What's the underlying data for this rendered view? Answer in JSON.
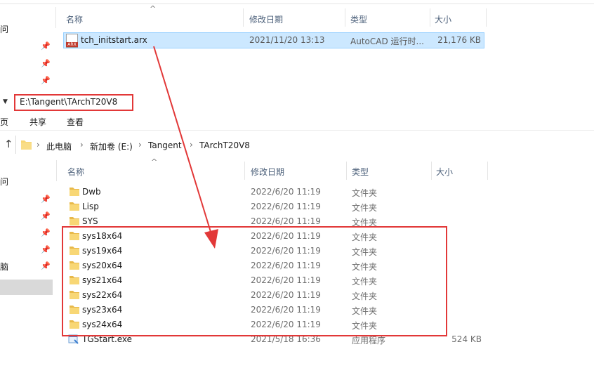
{
  "top_pane": {
    "columns": {
      "name": "名称",
      "date": "修改日期",
      "type": "类型",
      "size": "大小"
    },
    "file": {
      "name": "tch_initstart.arx",
      "date": "2021/11/20 13:13",
      "type": "AutoCAD 运行时...",
      "size": "21,176 KB",
      "icon_label": "ARX"
    },
    "nav_fragment": "问"
  },
  "address_overlay": {
    "path": "E:\\Tangent\\TArchT20V8"
  },
  "ribbon": {
    "fragment": "页",
    "share": "共享",
    "view": "查看"
  },
  "breadcrumb": {
    "items": [
      "此电脑",
      "新加卷 (E:)",
      "Tangent",
      "TArchT20V8"
    ]
  },
  "bottom_pane": {
    "columns": {
      "name": "名称",
      "date": "修改日期",
      "type": "类型",
      "size": "大小"
    },
    "nav_fragments": [
      "问",
      "脑"
    ],
    "rows": [
      {
        "name": "Dwb",
        "date": "2022/6/20 11:19",
        "type": "文件夹",
        "size": ""
      },
      {
        "name": "Lisp",
        "date": "2022/6/20 11:19",
        "type": "文件夹",
        "size": ""
      },
      {
        "name": "SYS",
        "date": "2022/6/20 11:19",
        "type": "文件夹",
        "size": ""
      },
      {
        "name": "sys18x64",
        "date": "2022/6/20 11:19",
        "type": "文件夹",
        "size": ""
      },
      {
        "name": "sys19x64",
        "date": "2022/6/20 11:19",
        "type": "文件夹",
        "size": ""
      },
      {
        "name": "sys20x64",
        "date": "2022/6/20 11:19",
        "type": "文件夹",
        "size": ""
      },
      {
        "name": "sys21x64",
        "date": "2022/6/20 11:19",
        "type": "文件夹",
        "size": ""
      },
      {
        "name": "sys22x64",
        "date": "2022/6/20 11:19",
        "type": "文件夹",
        "size": ""
      },
      {
        "name": "sys23x64",
        "date": "2022/6/20 11:19",
        "type": "文件夹",
        "size": ""
      },
      {
        "name": "sys24x64",
        "date": "2022/6/20 11:19",
        "type": "文件夹",
        "size": ""
      },
      {
        "name": "TGStart.exe",
        "date": "2021/5/18 16:36",
        "type": "应用程序",
        "size": "524 KB"
      }
    ]
  },
  "colors": {
    "highlight": "#e23838",
    "selection": "#cce8ff",
    "selection_border": "#99d1ff",
    "folder": "#f8d775"
  }
}
